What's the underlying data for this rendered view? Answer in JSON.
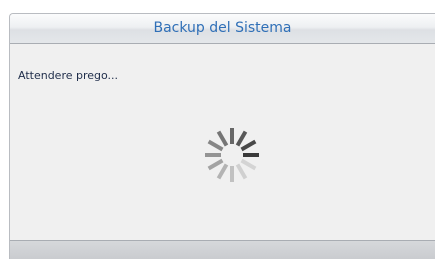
{
  "dialog": {
    "title": "Backup del Sistema",
    "message": "Attendere prego..."
  },
  "spinner": {
    "icon": "loading-spinner-icon",
    "color": "#3a3a3a"
  }
}
